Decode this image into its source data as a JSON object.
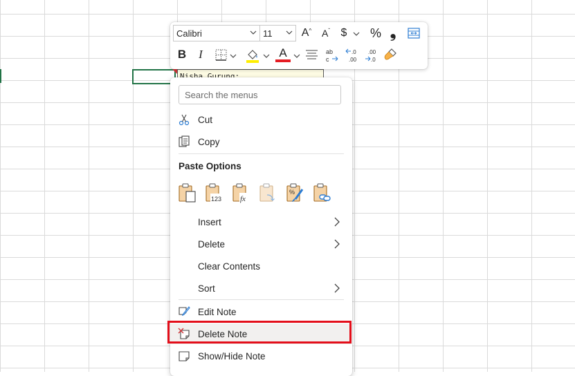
{
  "note": {
    "text": "Nisha Gurung:"
  },
  "mini_toolbar": {
    "font_name": "Calibri",
    "font_size": "11",
    "buttons": {
      "grow_font": "A",
      "shrink_font": "A",
      "currency": "$",
      "percent": "%",
      "comma": "❟",
      "bold": "B",
      "italic": "I",
      "font_color": "A"
    },
    "colors": {
      "fill_highlight": "#ffee00",
      "font_color_bar": "#e51c23",
      "accent": "#217346"
    }
  },
  "context_menu": {
    "search_placeholder": "Search the menus",
    "items": {
      "cut": "Cut",
      "copy": "Copy",
      "paste_options": "Paste Options",
      "insert": "Insert",
      "delete": "Delete",
      "clear_contents": "Clear Contents",
      "sort": "Sort",
      "edit_note": "Edit Note",
      "delete_note": "Delete Note",
      "show_hide_note": "Show/Hide Note"
    },
    "paste_icons": [
      "paste-icon",
      "paste-values-icon",
      "paste-formulas-icon",
      "paste-transpose-icon",
      "paste-formatting-icon",
      "paste-link-icon"
    ],
    "highlight_color": "#e30e1a"
  }
}
